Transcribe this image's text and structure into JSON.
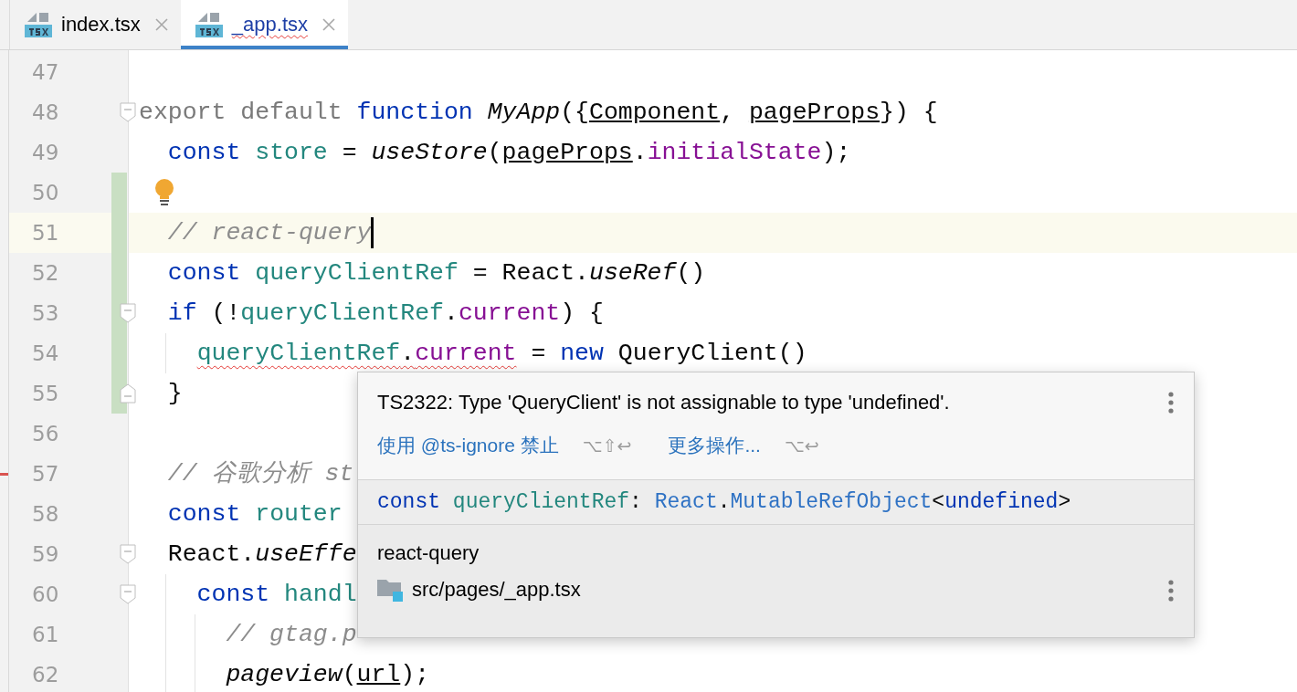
{
  "tabs": [
    {
      "label": "index.tsx",
      "selected": false,
      "error": false
    },
    {
      "label": "_app.tsx",
      "selected": true,
      "error": true
    }
  ],
  "editor": {
    "lines": [
      {
        "number": "47",
        "changed": false,
        "current": false
      },
      {
        "number": "48",
        "fold_start": true,
        "changed": false,
        "current": false,
        "tokens": [
          {
            "t": "export default ",
            "kind": "mod"
          },
          {
            "t": "function ",
            "kind": "kw"
          },
          {
            "t": "MyApp",
            "kind": "fn"
          },
          {
            "t": "({",
            "kind": "plain"
          },
          {
            "t": "Component",
            "kind": "param"
          },
          {
            "t": ", ",
            "kind": "plain"
          },
          {
            "t": "pageProps",
            "kind": "param"
          },
          {
            "t": "}) {",
            "kind": "plain"
          }
        ]
      },
      {
        "number": "49",
        "changed": false,
        "current": false,
        "tokens": [
          {
            "t": "  const ",
            "kind": "kw"
          },
          {
            "t": "store",
            "kind": "var"
          },
          {
            "t": " = ",
            "kind": "plain"
          },
          {
            "t": "useStore",
            "kind": "fn"
          },
          {
            "t": "(",
            "kind": "plain"
          },
          {
            "t": "pageProps",
            "kind": "param"
          },
          {
            "t": ".",
            "kind": "plain"
          },
          {
            "t": "initialState",
            "kind": "prop"
          },
          {
            "t": ");",
            "kind": "plain"
          }
        ]
      },
      {
        "number": "50",
        "changed": true,
        "current": false,
        "bulb": true
      },
      {
        "number": "51",
        "changed": true,
        "current": true,
        "caret": true,
        "tokens": [
          {
            "t": "  // react-query",
            "kind": "cm"
          }
        ]
      },
      {
        "number": "52",
        "changed": true,
        "current": false,
        "tokens": [
          {
            "t": "  const ",
            "kind": "kw"
          },
          {
            "t": "queryClientRef",
            "kind": "var"
          },
          {
            "t": " = React.",
            "kind": "plain"
          },
          {
            "t": "useRef",
            "kind": "fn"
          },
          {
            "t": "()",
            "kind": "plain"
          }
        ]
      },
      {
        "number": "53",
        "fold_start": true,
        "changed": true,
        "current": false,
        "tokens": [
          {
            "t": "  if ",
            "kind": "kw"
          },
          {
            "t": "(!",
            "kind": "plain"
          },
          {
            "t": "queryClientRef",
            "kind": "var"
          },
          {
            "t": ".",
            "kind": "plain"
          },
          {
            "t": "current",
            "kind": "prop"
          },
          {
            "t": ") {",
            "kind": "plain"
          }
        ]
      },
      {
        "number": "54",
        "changed": true,
        "current": false,
        "tokens": [
          {
            "t": "    queryClientRef",
            "kind": "var",
            "err": true
          },
          {
            "t": ".",
            "kind": "plain",
            "err": true
          },
          {
            "t": "current",
            "kind": "prop",
            "err": true
          },
          {
            "t": " = ",
            "kind": "plain"
          },
          {
            "t": "new ",
            "kind": "kw"
          },
          {
            "t": "QueryClient()",
            "kind": "plain"
          }
        ]
      },
      {
        "number": "55",
        "fold_end": true,
        "changed": true,
        "current": false,
        "tokens": [
          {
            "t": "  }",
            "kind": "plain"
          }
        ]
      },
      {
        "number": "56",
        "changed": false,
        "current": false
      },
      {
        "number": "57",
        "changed": false,
        "current": false,
        "problem": true,
        "tokens": [
          {
            "t": "  // 谷歌分析 st",
            "kind": "cm"
          }
        ]
      },
      {
        "number": "58",
        "changed": false,
        "current": false,
        "tokens": [
          {
            "t": "  const ",
            "kind": "kw"
          },
          {
            "t": "router",
            "kind": "var"
          }
        ]
      },
      {
        "number": "59",
        "fold_start": true,
        "changed": false,
        "current": false,
        "tokens": [
          {
            "t": "  React.",
            "kind": "plain"
          },
          {
            "t": "useEffe",
            "kind": "fn"
          }
        ]
      },
      {
        "number": "60",
        "fold_start": true,
        "changed": false,
        "current": false,
        "tokens": [
          {
            "t": "    const ",
            "kind": "kw"
          },
          {
            "t": "handl",
            "kind": "var"
          }
        ]
      },
      {
        "number": "61",
        "changed": false,
        "current": false,
        "tokens": [
          {
            "t": "      // gtag.p",
            "kind": "cm"
          }
        ]
      },
      {
        "number": "62",
        "changed": false,
        "current": false,
        "tokens": [
          {
            "t": "      pageview",
            "kind": "fn"
          },
          {
            "t": "(",
            "kind": "plain"
          },
          {
            "t": "url",
            "kind": "param"
          },
          {
            "t": ");",
            "kind": "plain"
          }
        ]
      }
    ]
  },
  "popup": {
    "message": "TS2322: Type 'QueryClient' is not assignable to type 'undefined'.",
    "actions": [
      {
        "label": "使用 @ts-ignore 禁止",
        "shortcut": "⌥⇧↩"
      },
      {
        "label": "更多操作...",
        "shortcut": "⌥↩"
      }
    ],
    "signature": [
      {
        "t": "const ",
        "kind": "kw"
      },
      {
        "t": "queryClientRef",
        "kind": "var"
      },
      {
        "t": ": ",
        "kind": "plain"
      },
      {
        "t": "React",
        "kind": "type"
      },
      {
        "t": ".",
        "kind": "plain"
      },
      {
        "t": "MutableRefObject",
        "kind": "type"
      },
      {
        "t": "<",
        "kind": "plain"
      },
      {
        "t": "undefined",
        "kind": "kw"
      },
      {
        "t": ">",
        "kind": "plain"
      }
    ],
    "doc": "react-query",
    "file": "src/pages/_app.tsx"
  }
}
